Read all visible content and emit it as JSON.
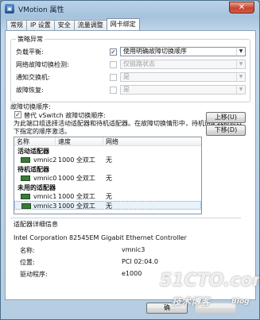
{
  "window": {
    "title": "VMotion 属性",
    "close_glyph": "✕"
  },
  "tabs": [
    "常规",
    "IP 设置",
    "安全",
    "流量调整",
    "网卡绑定"
  ],
  "policy": {
    "group_label": "策略异常",
    "rows": [
      {
        "label": "负载平衡:",
        "checked": true,
        "value": "使用明确故障切换顺序"
      },
      {
        "label": "网络故障切换检测:",
        "checked": false,
        "value": "仅链路状态"
      },
      {
        "label": "通知交换机:",
        "checked": false,
        "value": "是"
      },
      {
        "label": "故障恢复:",
        "checked": false,
        "value": "是"
      }
    ]
  },
  "failover": {
    "group_label": "故障切换顺序:",
    "override_label": "替代 vSwitch 故障切换顺序:",
    "override_checked": true,
    "description": "为此端口组选择活动适配器和待机适配器。在故障切换情形中，待机适配器按照以下指定的顺序激活。",
    "columns": [
      "名称",
      "速度",
      "网络"
    ],
    "sections": [
      {
        "title": "活动适配器",
        "nics": [
          {
            "name": "vmnic2",
            "speed": "1000 全双工",
            "network": "无",
            "selected": false
          }
        ]
      },
      {
        "title": "待机适配器",
        "nics": [
          {
            "name": "vmnic0",
            "speed": "1000 全双工",
            "network": "无",
            "selected": false
          }
        ]
      },
      {
        "title": "未用的适配器",
        "nics": [
          {
            "name": "vmnic1",
            "speed": "1000 全双工",
            "network": "无",
            "selected": false
          },
          {
            "name": "vmnic3",
            "speed": "1000 全双工",
            "network": "无",
            "selected": true
          }
        ]
      }
    ],
    "move_up": "上移(U)",
    "move_down": "下移(D)"
  },
  "details": {
    "group_label": "适配器详细信息",
    "controller": "Intel Corporation 82545EM Gigabit Ethernet Controller",
    "rows": [
      {
        "label": "名称:",
        "value": "vmnic3"
      },
      {
        "label": "位置:",
        "value": "PCI 02:04.0"
      },
      {
        "label": "驱动程序:",
        "value": "e1000"
      }
    ]
  },
  "footer": {
    "ok": "确",
    "cancel": "取消"
  },
  "watermark": {
    "site": "51CTO.com",
    "sub": "技术博客",
    "blog": "Blog"
  }
}
